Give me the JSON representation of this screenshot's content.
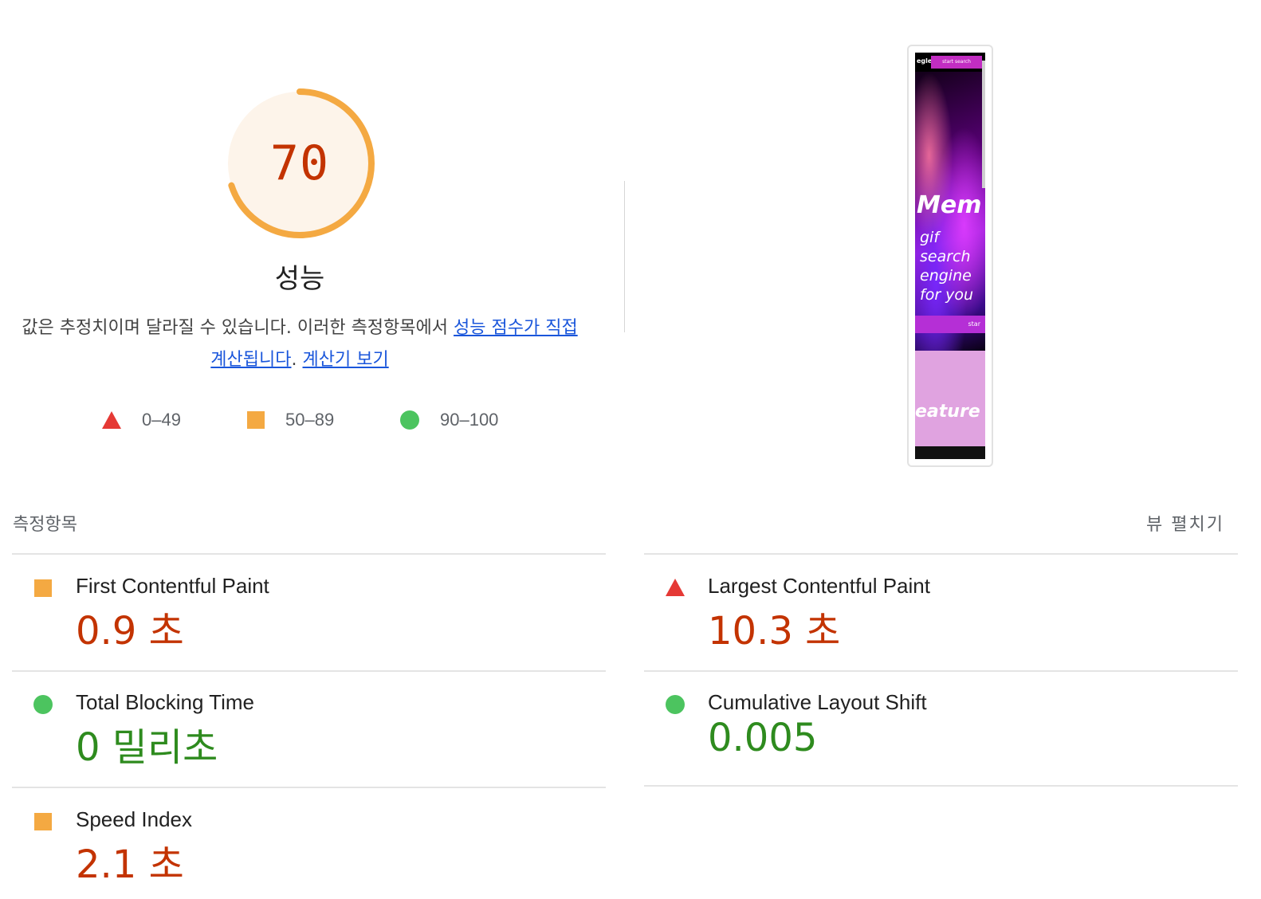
{
  "gauge": {
    "score": "70",
    "score_fraction": 0.7,
    "title": "성능",
    "color": "#f4a942",
    "bg_color": "#fdf4ea",
    "text_color": "#c33300"
  },
  "description": {
    "text": "값은 추정치이며 달라질 수 있습니다. 이러한 측정항목에서 ",
    "link1": "성능 점수가 직접 계산됩니다",
    "period": ". ",
    "link2": "계산기 보기"
  },
  "scale": [
    {
      "icon": "fail-triangle-icon",
      "label": "0–49",
      "color": "#e53935"
    },
    {
      "icon": "average-square-icon",
      "label": "50–89",
      "color": "#f4a942"
    },
    {
      "icon": "pass-circle-icon",
      "label": "90–100",
      "color": "#4cc45f"
    }
  ],
  "screenshot": {
    "logo": "egle",
    "search_button": "start search",
    "hero_title": "Mem",
    "tagline": "gif search engine for you",
    "start_button": "star",
    "features_text": "eature"
  },
  "metrics_header": {
    "title": "측정항목",
    "expand": "뷰 펼치기"
  },
  "metrics": [
    {
      "name": "First Contentful Paint",
      "value": "0.9 초",
      "rating": "average"
    },
    {
      "name": "Largest Contentful Paint",
      "value": "10.3 초",
      "rating": "fail"
    },
    {
      "name": "Total Blocking Time",
      "value": "0 밀리초",
      "rating": "pass"
    },
    {
      "name": "Cumulative Layout Shift",
      "value": "0.005",
      "rating": "pass"
    },
    {
      "name": "Speed Index",
      "value": "2.1 초",
      "rating": "average"
    }
  ]
}
